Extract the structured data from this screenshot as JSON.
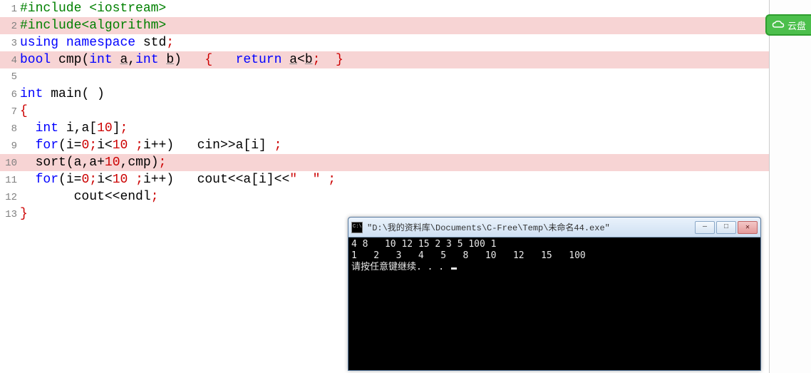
{
  "code": {
    "lines": [
      {
        "n": "1",
        "hl": false,
        "tokens": [
          {
            "c": "tok-pre",
            "t": "#include <iostream>"
          }
        ]
      },
      {
        "n": "2",
        "hl": true,
        "tokens": [
          {
            "c": "tok-pre",
            "t": "#include<algorithm>"
          }
        ]
      },
      {
        "n": "3",
        "hl": false,
        "tokens": [
          {
            "c": "tok-kw",
            "t": "using"
          },
          {
            "c": "tok-p",
            "t": " "
          },
          {
            "c": "tok-kw",
            "t": "namespace"
          },
          {
            "c": "tok-p",
            "t": " "
          },
          {
            "c": "tok-id",
            "t": "std"
          },
          {
            "c": "tok-se",
            "t": ";"
          }
        ]
      },
      {
        "n": "4",
        "hl": true,
        "tokens": [
          {
            "c": "tok-type",
            "t": "bool"
          },
          {
            "c": "tok-p",
            "t": " "
          },
          {
            "c": "tok-id",
            "t": "cmp"
          },
          {
            "c": "tok-p",
            "t": "("
          },
          {
            "c": "tok-type",
            "t": "int"
          },
          {
            "c": "tok-p",
            "t": " "
          },
          {
            "c": "tok-id underline",
            "t": "a"
          },
          {
            "c": "tok-p",
            "t": ","
          },
          {
            "c": "tok-type",
            "t": "int"
          },
          {
            "c": "tok-p",
            "t": " "
          },
          {
            "c": "tok-id underline",
            "t": "b"
          },
          {
            "c": "tok-p",
            "t": ")   "
          },
          {
            "c": "tok-br",
            "t": "{"
          },
          {
            "c": "tok-p",
            "t": "   "
          },
          {
            "c": "tok-kw",
            "t": "return"
          },
          {
            "c": "tok-p",
            "t": " "
          },
          {
            "c": "tok-id underline",
            "t": "a"
          },
          {
            "c": "tok-op",
            "t": "<"
          },
          {
            "c": "tok-id underline",
            "t": "b"
          },
          {
            "c": "tok-se",
            "t": ";"
          },
          {
            "c": "tok-p",
            "t": "  "
          },
          {
            "c": "tok-br",
            "t": "}"
          }
        ]
      },
      {
        "n": "5",
        "hl": false,
        "tokens": []
      },
      {
        "n": "6",
        "hl": false,
        "tokens": [
          {
            "c": "tok-type",
            "t": "int"
          },
          {
            "c": "tok-p",
            "t": " "
          },
          {
            "c": "tok-id",
            "t": "main"
          },
          {
            "c": "tok-p",
            "t": "( )"
          }
        ]
      },
      {
        "n": "7",
        "hl": false,
        "tokens": [
          {
            "c": "tok-br",
            "t": "{"
          }
        ]
      },
      {
        "n": "8",
        "hl": false,
        "tokens": [
          {
            "c": "tok-p",
            "t": "  "
          },
          {
            "c": "tok-type",
            "t": "int"
          },
          {
            "c": "tok-p",
            "t": " "
          },
          {
            "c": "tok-id",
            "t": "i"
          },
          {
            "c": "tok-p",
            "t": ","
          },
          {
            "c": "tok-id",
            "t": "a"
          },
          {
            "c": "tok-p",
            "t": "["
          },
          {
            "c": "tok-num",
            "t": "10"
          },
          {
            "c": "tok-p",
            "t": "]"
          },
          {
            "c": "tok-se",
            "t": ";"
          }
        ]
      },
      {
        "n": "9",
        "hl": false,
        "tokens": [
          {
            "c": "tok-p",
            "t": "  "
          },
          {
            "c": "tok-kw",
            "t": "for"
          },
          {
            "c": "tok-p",
            "t": "("
          },
          {
            "c": "tok-id",
            "t": "i"
          },
          {
            "c": "tok-op",
            "t": "="
          },
          {
            "c": "tok-num",
            "t": "0"
          },
          {
            "c": "tok-se",
            "t": ";"
          },
          {
            "c": "tok-id",
            "t": "i"
          },
          {
            "c": "tok-op",
            "t": "<"
          },
          {
            "c": "tok-num",
            "t": "10"
          },
          {
            "c": "tok-p",
            "t": " "
          },
          {
            "c": "tok-se",
            "t": ";"
          },
          {
            "c": "tok-id",
            "t": "i"
          },
          {
            "c": "tok-op",
            "t": "++"
          },
          {
            "c": "tok-p",
            "t": ")   "
          },
          {
            "c": "tok-id",
            "t": "cin"
          },
          {
            "c": "tok-op",
            "t": ">>"
          },
          {
            "c": "tok-id",
            "t": "a"
          },
          {
            "c": "tok-p",
            "t": "["
          },
          {
            "c": "tok-id",
            "t": "i"
          },
          {
            "c": "tok-p",
            "t": "] "
          },
          {
            "c": "tok-se",
            "t": ";"
          }
        ]
      },
      {
        "n": "10",
        "hl": true,
        "tokens": [
          {
            "c": "tok-p",
            "t": "  "
          },
          {
            "c": "tok-id",
            "t": "sort"
          },
          {
            "c": "tok-p",
            "t": "("
          },
          {
            "c": "tok-id",
            "t": "a"
          },
          {
            "c": "tok-p",
            "t": ","
          },
          {
            "c": "tok-id",
            "t": "a"
          },
          {
            "c": "tok-op",
            "t": "+"
          },
          {
            "c": "tok-num",
            "t": "10"
          },
          {
            "c": "tok-p",
            "t": ","
          },
          {
            "c": "tok-id",
            "t": "cmp"
          },
          {
            "c": "tok-p",
            "t": ")"
          },
          {
            "c": "tok-se",
            "t": ";"
          }
        ]
      },
      {
        "n": "11",
        "hl": false,
        "tokens": [
          {
            "c": "tok-p",
            "t": "  "
          },
          {
            "c": "tok-kw",
            "t": "for"
          },
          {
            "c": "tok-p",
            "t": "("
          },
          {
            "c": "tok-id",
            "t": "i"
          },
          {
            "c": "tok-op",
            "t": "="
          },
          {
            "c": "tok-num",
            "t": "0"
          },
          {
            "c": "tok-se",
            "t": ";"
          },
          {
            "c": "tok-id",
            "t": "i"
          },
          {
            "c": "tok-op",
            "t": "<"
          },
          {
            "c": "tok-num",
            "t": "10"
          },
          {
            "c": "tok-p",
            "t": " "
          },
          {
            "c": "tok-se",
            "t": ";"
          },
          {
            "c": "tok-id",
            "t": "i"
          },
          {
            "c": "tok-op",
            "t": "++"
          },
          {
            "c": "tok-p",
            "t": ")   "
          },
          {
            "c": "tok-id",
            "t": "cout"
          },
          {
            "c": "tok-op",
            "t": "<<"
          },
          {
            "c": "tok-id",
            "t": "a"
          },
          {
            "c": "tok-p",
            "t": "["
          },
          {
            "c": "tok-id",
            "t": "i"
          },
          {
            "c": "tok-p",
            "t": "]"
          },
          {
            "c": "tok-op",
            "t": "<<"
          },
          {
            "c": "tok-num",
            "t": "\"  \""
          },
          {
            "c": "tok-p",
            "t": " "
          },
          {
            "c": "tok-se",
            "t": ";"
          }
        ]
      },
      {
        "n": "12",
        "hl": false,
        "tokens": [
          {
            "c": "tok-p",
            "t": "       "
          },
          {
            "c": "tok-id",
            "t": "cout"
          },
          {
            "c": "tok-op",
            "t": "<<"
          },
          {
            "c": "tok-id",
            "t": "endl"
          },
          {
            "c": "tok-se",
            "t": ";"
          }
        ]
      },
      {
        "n": "13",
        "hl": false,
        "tokens": [
          {
            "c": "tok-br",
            "t": "}"
          }
        ]
      }
    ]
  },
  "console": {
    "title": "\"D:\\我的资料库\\Documents\\C-Free\\Temp\\未命名44.exe\"",
    "lines": [
      "4 8   10 12 15 2 3 5 100 1",
      "1   2   3   4   5   8   10   12   15   100",
      "请按任意键继续. . . "
    ]
  },
  "cloud": {
    "label": "云盘"
  },
  "win_controls": {
    "min": "—",
    "max": "□",
    "close": "✕"
  }
}
